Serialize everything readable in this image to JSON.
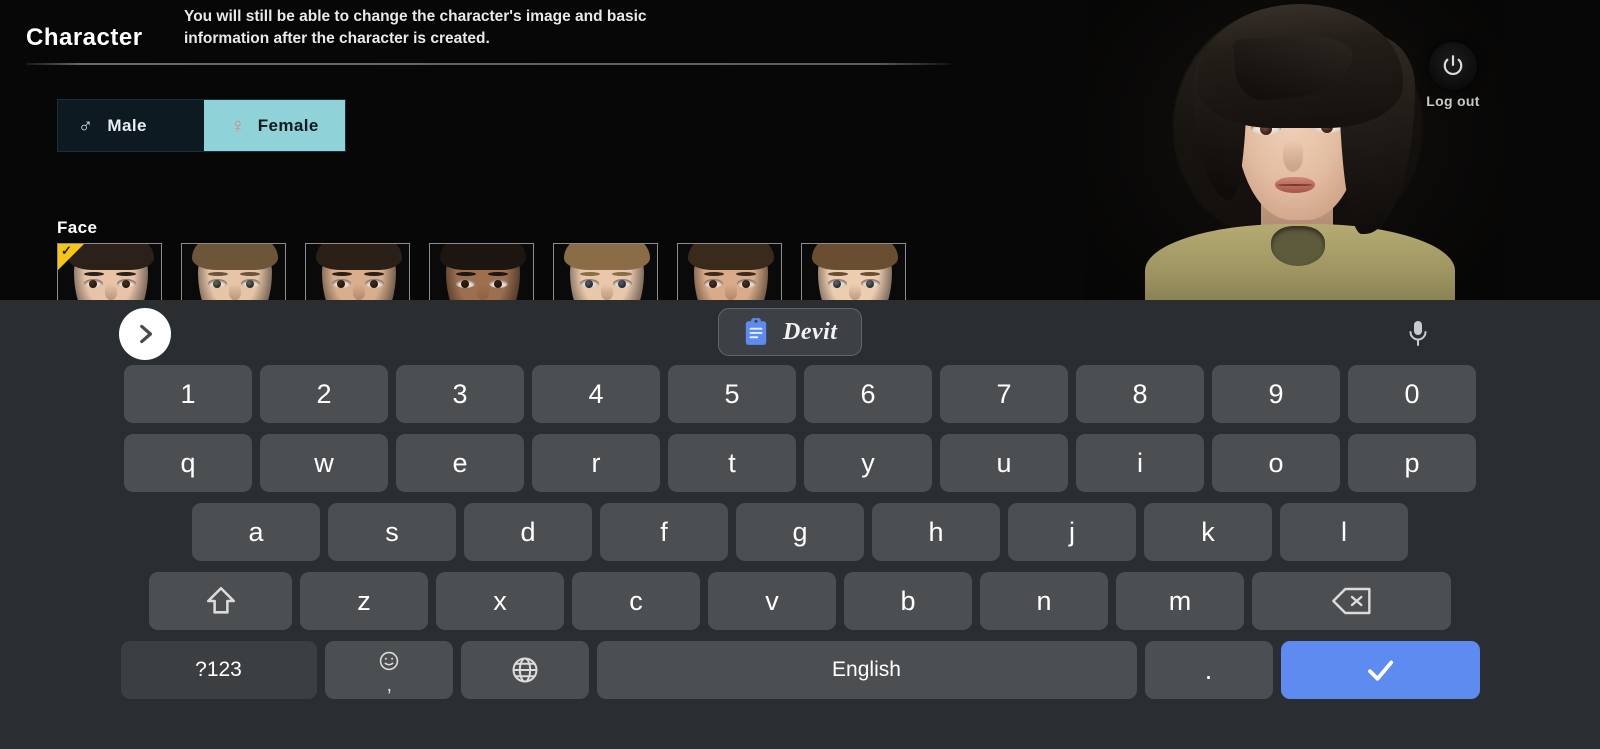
{
  "screen": {
    "title": "Character",
    "subtitle": "You will still be able to change the character's image and basic information after the character is created."
  },
  "gender": {
    "male_label": "Male",
    "male_symbol": "♂",
    "female_label": "Female",
    "female_symbol": "♀",
    "selected": "Female",
    "selected_bg": "#8fd2d8",
    "panel_bg": "#0d1a22"
  },
  "face": {
    "label": "Face",
    "selected_index": 0,
    "selection_marker_color": "#f5c518",
    "selection_check": "✓",
    "thumbnails": [
      {
        "name": "face-1",
        "skin": "#e8c3a8",
        "hair": "#2b211a",
        "iris": "#4a2e1c"
      },
      {
        "name": "face-2",
        "skin": "#e6c4a6",
        "hair": "#6d553a",
        "iris": "#5b6e5a"
      },
      {
        "name": "face-3",
        "skin": "#d8ae8c",
        "hair": "#2a2018",
        "iris": "#3f2c1b"
      },
      {
        "name": "face-4",
        "skin": "#9d6f4f",
        "hair": "#1d1510",
        "iris": "#332115"
      },
      {
        "name": "face-5",
        "skin": "#e9c7aa",
        "hair": "#8a6c46",
        "iris": "#4f6274"
      },
      {
        "name": "face-6",
        "skin": "#d9ab88",
        "hair": "#3a2a1c",
        "iris": "#4a3423"
      },
      {
        "name": "face-7",
        "skin": "#edcdb0",
        "hair": "#6a4e32",
        "iris": "#5a6b78"
      }
    ]
  },
  "logout": {
    "label": "Log out",
    "icon": "power-icon"
  },
  "keyboard": {
    "background": "#2b2e31",
    "key_color": "#4b4f52",
    "key_dark_color": "#3b3f42",
    "accent_color": "#5d8bf0",
    "expand_icon": "chevron-right-icon",
    "mic_icon": "microphone-icon",
    "clipboard": {
      "icon": "clipboard-icon",
      "text": "Devit",
      "icon_color": "#5d8bf0"
    },
    "rows": [
      {
        "name": "number-row",
        "keys": [
          "1",
          "2",
          "3",
          "4",
          "5",
          "6",
          "7",
          "8",
          "9",
          "0"
        ]
      },
      {
        "name": "letter-row-1",
        "keys": [
          "q",
          "w",
          "e",
          "r",
          "t",
          "y",
          "u",
          "i",
          "o",
          "p"
        ]
      },
      {
        "name": "letter-row-2",
        "keys": [
          "a",
          "s",
          "d",
          "f",
          "g",
          "h",
          "j",
          "k",
          "l"
        ]
      },
      {
        "name": "letter-row-3",
        "keys": [
          "z",
          "x",
          "c",
          "v",
          "b",
          "n",
          "m"
        ]
      }
    ],
    "special": {
      "shift_label": "shift-icon",
      "backspace_label": "backspace-icon",
      "symbols_label": "?123",
      "emoji_label": "emoji-icon",
      "globe_label": "globe-icon",
      "space_label": "English",
      "period_label": ".",
      "enter_label": "check-icon"
    }
  }
}
